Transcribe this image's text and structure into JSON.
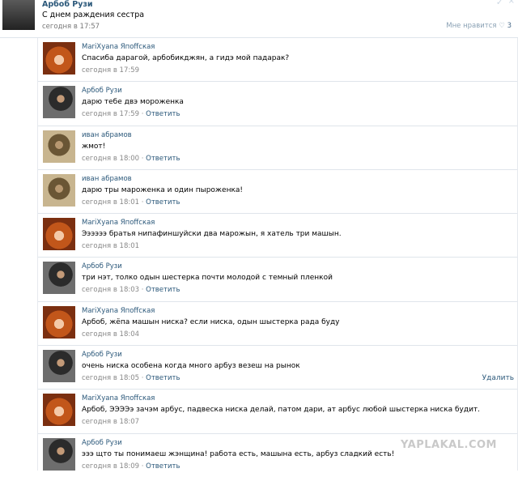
{
  "post": {
    "author": "Арбоб Рузи",
    "text": "С днем раждения сестра",
    "time": "сегодня в 17:57",
    "like_label": "Мне нравится",
    "like_count": "3"
  },
  "comments": [
    {
      "author": "MariXyana Япоffская",
      "text": "Спасиба дарагой, арбобикджян, а гидэ мой падарак?",
      "time": "сегодня в 17:59",
      "reply": "",
      "avatar": "girl"
    },
    {
      "author": "Арбоб Рузи",
      "text": "дарю тебе двэ мороженка",
      "time": "сегодня в 17:59",
      "reply": "Ответить",
      "avatar": "man"
    },
    {
      "author": "иван абрамов",
      "text": "жмот!",
      "time": "сегодня в 18:00",
      "reply": "Ответить",
      "avatar": "old"
    },
    {
      "author": "иван абрамов",
      "text": "дарю тры мароженка и один пыроженка!",
      "time": "сегодня в 18:01",
      "reply": "Ответить",
      "avatar": "old"
    },
    {
      "author": "MariXyana Япоffская",
      "text": "Ээээээ братья нипафиншуйски два марожын, я хатель три машын.",
      "time": "сегодня в 18:01",
      "reply": "",
      "avatar": "girl"
    },
    {
      "author": "Арбоб Рузи",
      "text": "три нэт, толко одын шестерка почти молодой с темный пленкой",
      "time": "сегодня в 18:03",
      "reply": "Ответить",
      "avatar": "man"
    },
    {
      "author": "MariXyana Япоffская",
      "text": "Арбоб, жёпа машын ниска? если ниска, одын шыстерка рада буду",
      "time": "сегодня в 18:04",
      "reply": "",
      "avatar": "girl"
    },
    {
      "author": "Арбоб Рузи",
      "text": "очень ниска особена когда много арбуз везеш на рынок",
      "time": "сегодня в 18:05",
      "reply": "Ответить",
      "avatar": "man",
      "delete": "Удалить"
    },
    {
      "author": "MariXyana Япоffская",
      "text": "Арбоб, ЭЭЭЭэ зачэм арбус, падвеска ниска делай, патом дари, ат арбус любой шыстерка ниска будит.",
      "time": "сегодня в 18:07",
      "reply": "",
      "avatar": "girl"
    },
    {
      "author": "Арбоб Рузи",
      "text": "эээ щто ты понимаеш жэнщина! работа есть, машына есть, арбуз сладкий есть!",
      "time": "сегодня в 18:09",
      "reply": "Ответить",
      "avatar": "man"
    }
  ],
  "watermark": "YAPLAKAL.COM"
}
